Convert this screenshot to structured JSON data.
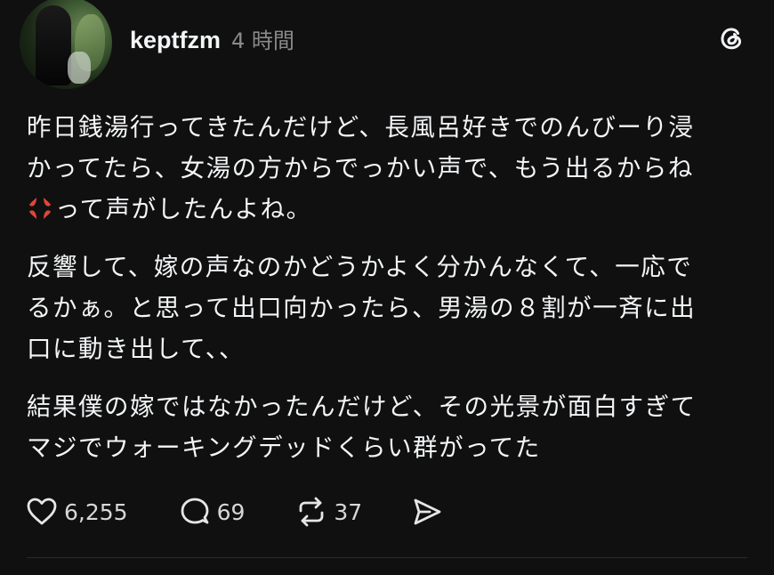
{
  "post": {
    "username": "keptfzm",
    "time": "4 時間",
    "paragraphs": [
      [
        "昨日銭湯行ってきたんだけど、長風呂好きでのんびーり浸",
        "かってたら、女湯の方からでっかい声で、もう出るからね"
      ],
      [
        "反響して、嫁の声なのかどうかよく分かんなくて、一応で",
        "るかぁ。と思って出口向かったら、男湯の８割が一斉に出",
        "口に動き出して、、"
      ],
      [
        "結果僕の嫁ではなかったんだけど、その光景が面白すぎて",
        "マジでウォーキングデッドくらい群がってた"
      ]
    ],
    "emoji_line": "って声がしたんよね。",
    "emoji_icon": "anger-symbol-emoji"
  },
  "actions": {
    "likes": "6,255",
    "replies": "69",
    "reposts": "37"
  },
  "colors": {
    "background": "#101010",
    "text": "#f3f5f7",
    "muted": "#8a8a8a",
    "anger": "#e0463a"
  }
}
